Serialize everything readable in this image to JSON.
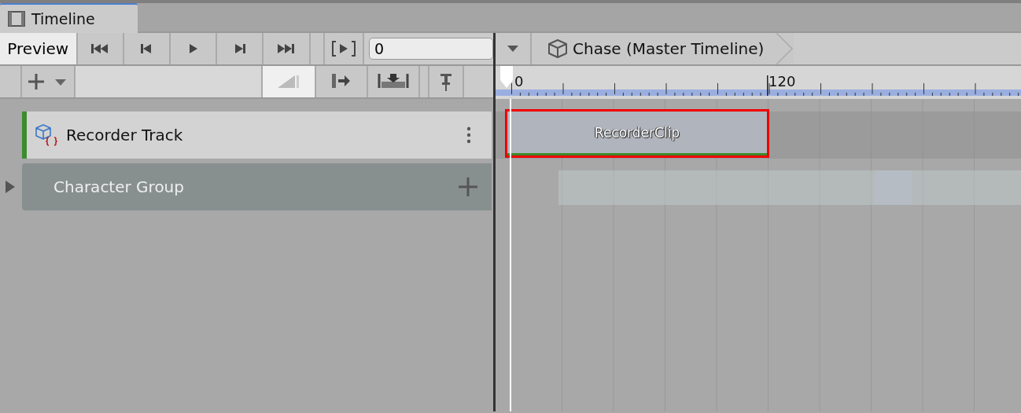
{
  "tab": {
    "title": "Timeline"
  },
  "toolbar": {
    "preview": "Preview",
    "frame_field": "0"
  },
  "breadcrumb": {
    "title": "Chase (Master Timeline)"
  },
  "ruler": {
    "labels": [
      "0",
      "120"
    ]
  },
  "tracks": [
    {
      "kind": "track",
      "name": "Recorder Track",
      "clips": [
        {
          "name": "RecorderClip",
          "selected": true
        }
      ]
    },
    {
      "kind": "group",
      "name": "Character Group",
      "expanded": false
    }
  ]
}
